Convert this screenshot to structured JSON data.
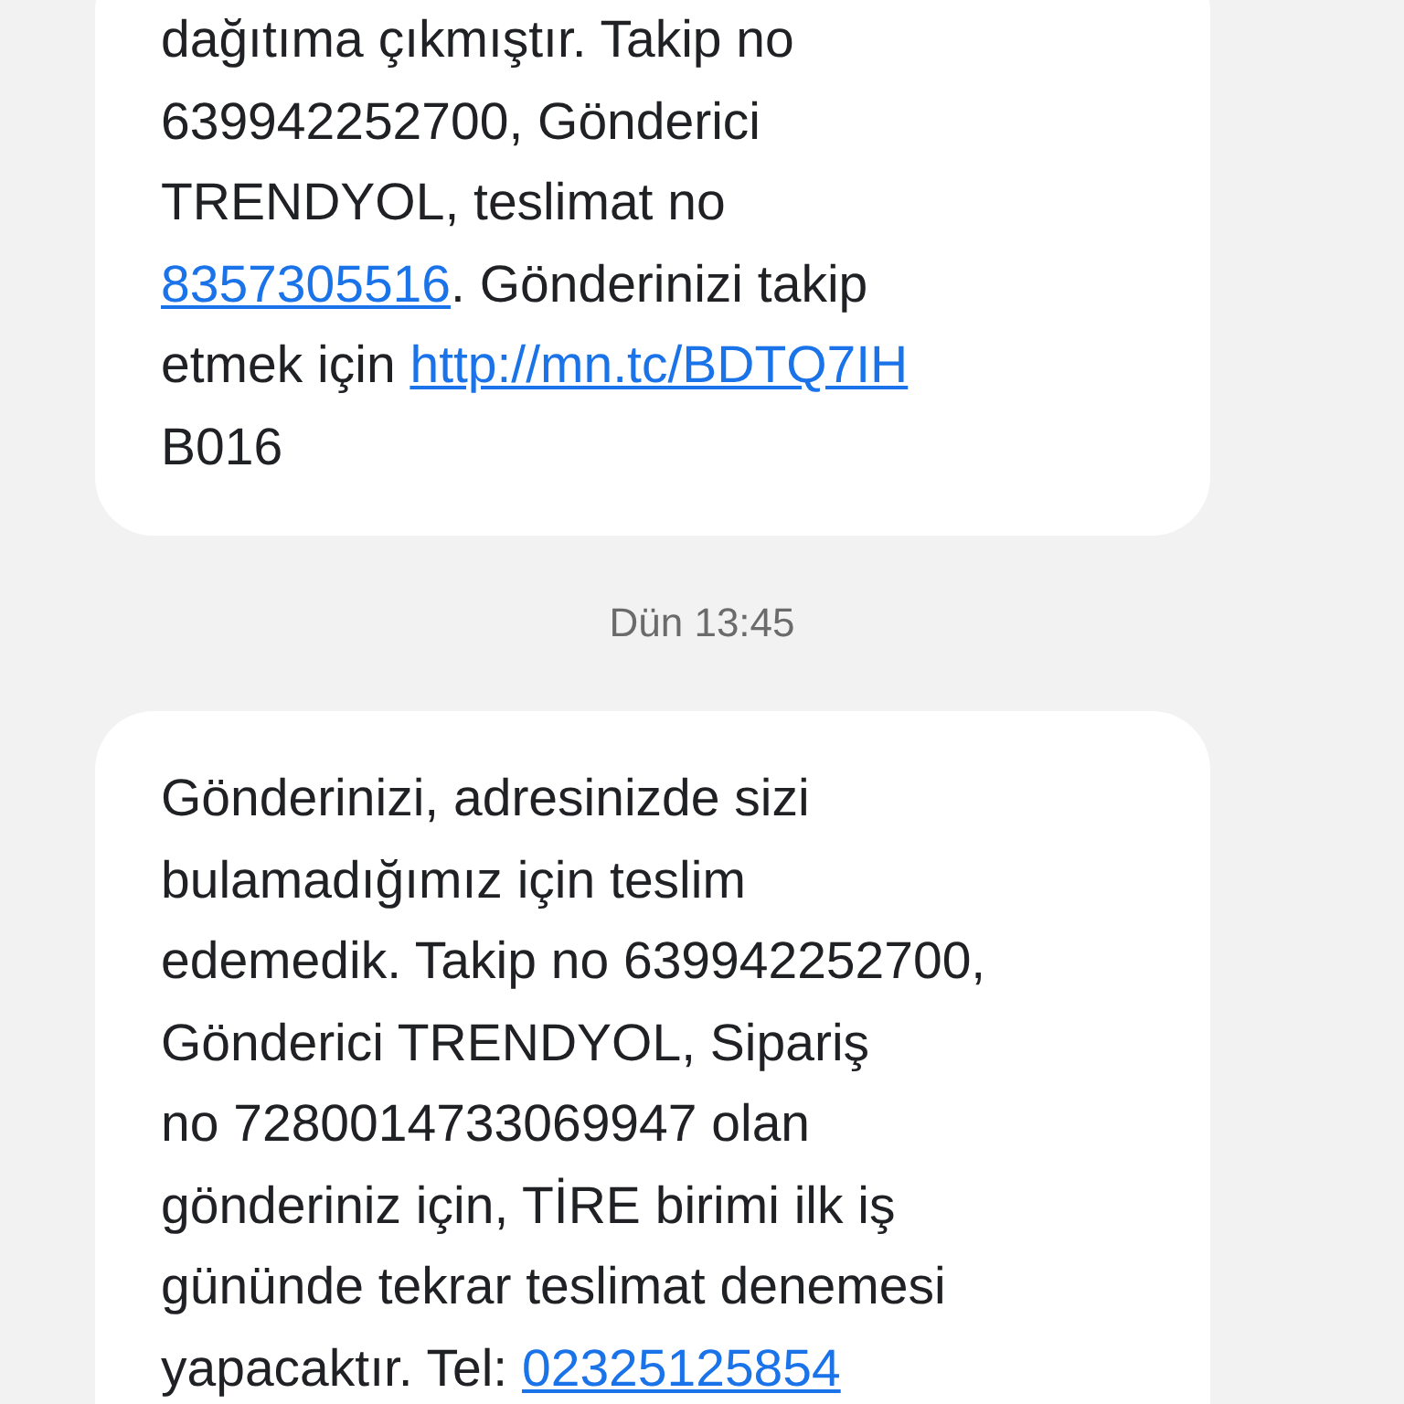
{
  "messages": [
    {
      "kind": "message",
      "lines": [
        [
          {
            "kind": "text",
            "text": "dağıtıma çıkmıştır. Takip no"
          }
        ],
        [
          {
            "kind": "text",
            "text": "639942252700, Gönderici"
          }
        ],
        [
          {
            "kind": "text",
            "text": "TRENDYOL, teslimat no"
          }
        ],
        [
          {
            "kind": "link",
            "text": "8357305516"
          },
          {
            "kind": "text",
            "text": ". Gönderinizi takip"
          }
        ],
        [
          {
            "kind": "text",
            "text": "etmek için "
          },
          {
            "kind": "link",
            "text": "http://mn.tc/BDTQ7IH"
          }
        ],
        [
          {
            "kind": "text",
            "text": "B016"
          }
        ]
      ]
    },
    {
      "kind": "timestamp",
      "text": "Dün 13:45"
    },
    {
      "kind": "message",
      "lines": [
        [
          {
            "kind": "text",
            "text": "Gönderinizi, adresinizde sizi"
          }
        ],
        [
          {
            "kind": "text",
            "text": "bulamadığımız için teslim"
          }
        ],
        [
          {
            "kind": "text",
            "text": "edemedik. Takip no 639942252700,"
          }
        ],
        [
          {
            "kind": "text",
            "text": "Gönderici TRENDYOL, Sipariş"
          }
        ],
        [
          {
            "kind": "text",
            "text": "no 7280014733069947 olan"
          }
        ],
        [
          {
            "kind": "text",
            "text": "gönderiniz için, TİRE birimi ilk iş"
          }
        ],
        [
          {
            "kind": "text",
            "text": "gününde tekrar teslimat denemesi"
          }
        ],
        [
          {
            "kind": "text",
            "text": "yapacaktır. Tel: "
          },
          {
            "kind": "link",
            "text": "02325125854"
          }
        ]
      ]
    }
  ]
}
